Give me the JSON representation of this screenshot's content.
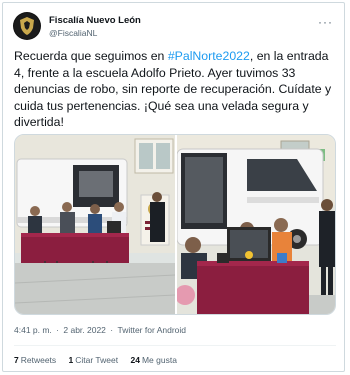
{
  "tweet": {
    "author_name": "Fiscalía Nuevo León",
    "author_handle": "@FiscaliaNL",
    "more_icon": "more-options-icon",
    "text_before": "Recuerda que seguimos en ",
    "hashtag": "#PalNorte2022",
    "text_after": ", en la entrada 4, frente a la escuela Adolfo Prieto. Ayer tuvimos 33 denuncias de robo, sin reporte de recuperación. Cuídate y cuida tus pertenencias. ¡Qué sea una velada segura y divertida!",
    "time": "4:41 p. m.",
    "date": "2 abr. 2022",
    "source": "Twitter for Android",
    "separator": "·"
  },
  "stats": {
    "retweets_count": "7",
    "retweets_label": "Retweets",
    "quotes_count": "1",
    "quotes_label": "Citar Tweet",
    "likes_count": "24",
    "likes_label": "Me gusta"
  },
  "colors": {
    "hashtag": "#1d9bf0",
    "secondary_text": "#536471",
    "tent_maroon": "#8b1e3f"
  }
}
